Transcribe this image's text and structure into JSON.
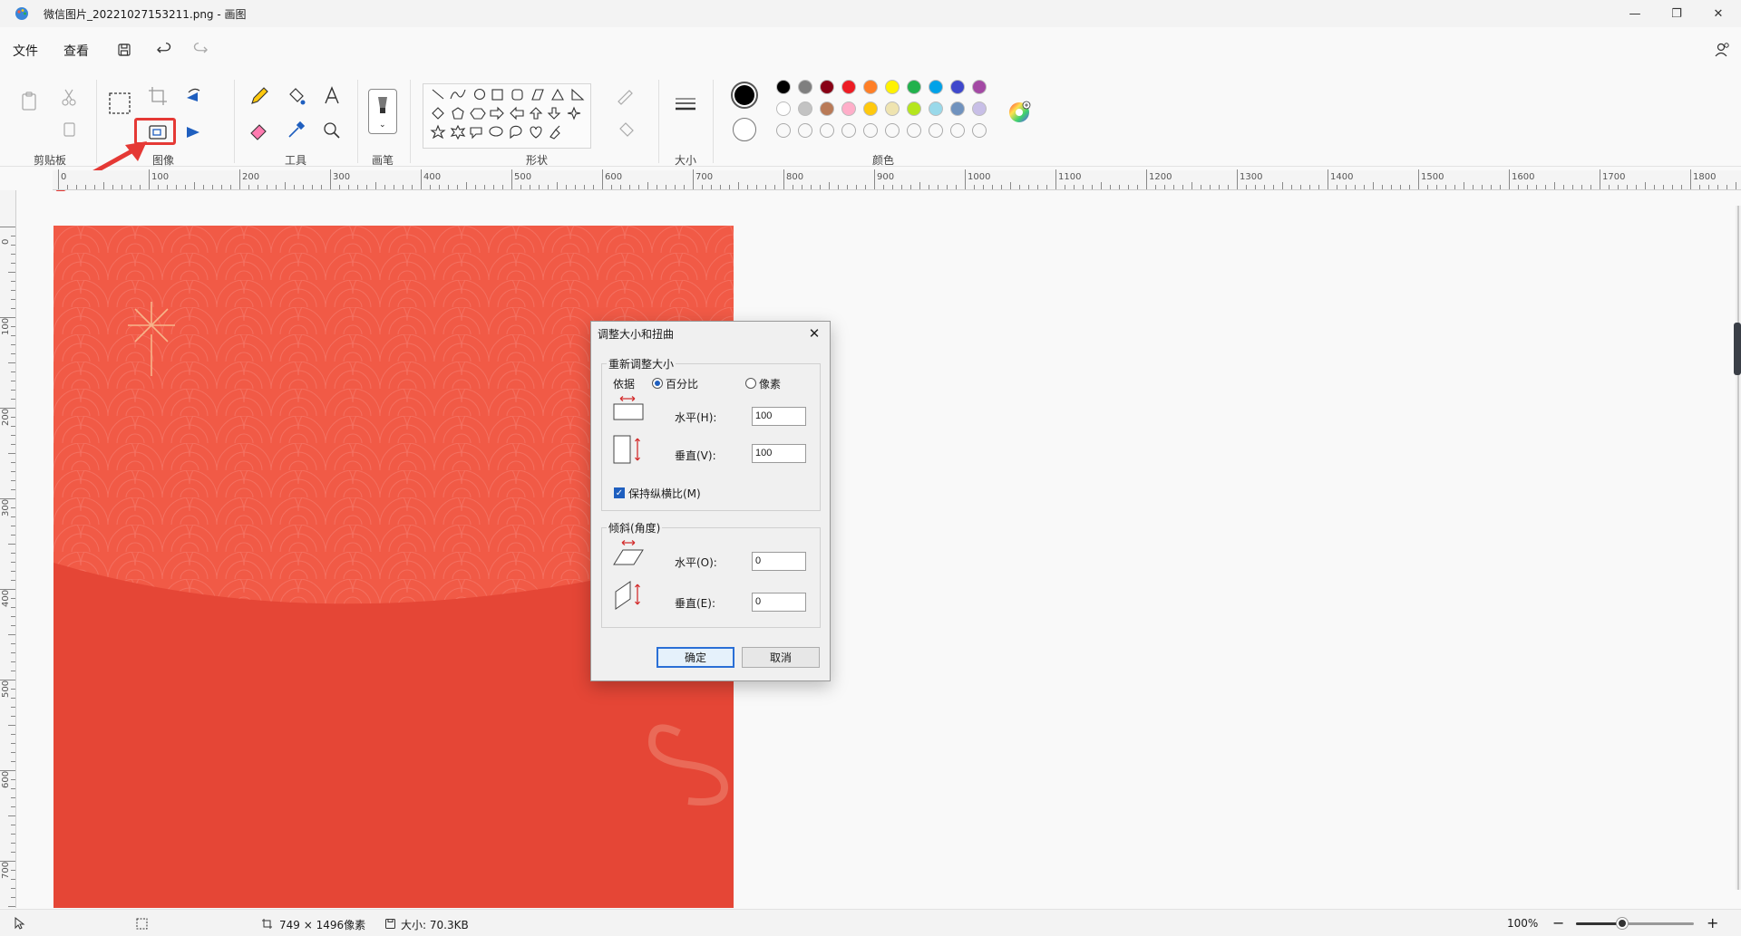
{
  "window": {
    "title": "微信图片_20221027153211.png - 画图",
    "minimize": "—",
    "maximize": "❐",
    "close": "✕"
  },
  "menu": {
    "file": "文件",
    "view": "查看"
  },
  "ribbon": {
    "groups": {
      "clipboard": "剪贴板",
      "image": "图像",
      "tools": "工具",
      "brushes": "画笔",
      "shapes": "形状",
      "size": "大小",
      "colors": "颜色"
    },
    "palette_row1": [
      "#000000",
      "#7f7f7f",
      "#880015",
      "#ed1c24",
      "#ff7f27",
      "#fff200",
      "#22b14c",
      "#00a2e8",
      "#3f48cc",
      "#a349a4"
    ],
    "palette_row2": [
      "#ffffff",
      "#c3c3c3",
      "#b97a57",
      "#ffaec9",
      "#ffc90e",
      "#efe4b0",
      "#b5e61d",
      "#99d9ea",
      "#7092be",
      "#c8bfe7"
    ],
    "primary_color": "#000000",
    "secondary_color": "#ffffff"
  },
  "ruler": {
    "h_labels": [
      "0",
      "100",
      "200",
      "300",
      "400",
      "500",
      "600",
      "700",
      "800",
      "900",
      "1000",
      "1100",
      "1200",
      "1300",
      "1400",
      "1500",
      "1600",
      "1700",
      "1800"
    ],
    "v_labels": [
      "0",
      "100",
      "200",
      "300",
      "400",
      "500",
      "600",
      "700"
    ]
  },
  "dialog": {
    "title": "调整大小和扭曲",
    "resize_legend": "重新调整大小",
    "by_label": "依据",
    "percent_label": "百分比",
    "pixels_label": "像素",
    "horizontal_label": "水平(H):",
    "horizontal_value": "100",
    "vertical_label": "垂直(V):",
    "vertical_value": "100",
    "keep_ratio_label": "保持纵横比(M)",
    "skew_legend": "倾斜(角度)",
    "skew_h_label": "水平(O):",
    "skew_h_value": "0",
    "skew_v_label": "垂直(E):",
    "skew_v_value": "0",
    "ok_label": "确定",
    "cancel_label": "取消"
  },
  "status": {
    "dimensions": "749 × 1496像素",
    "filesize": "大小: 70.3KB",
    "zoom": "100%"
  }
}
